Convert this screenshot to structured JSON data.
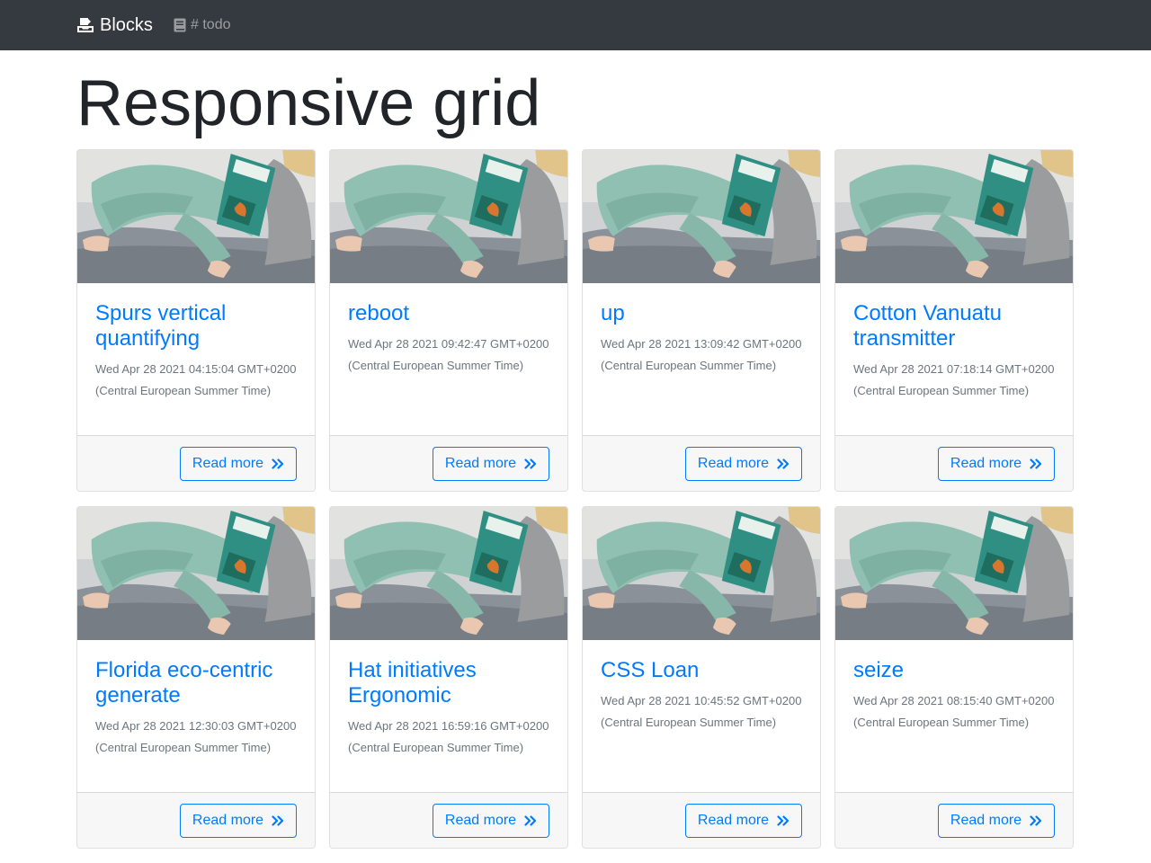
{
  "navbar": {
    "brand_label": "Blocks",
    "brand_icon": "inbox-tray-icon",
    "link_label": "# todo",
    "link_icon": "book-icon"
  },
  "page": {
    "title": "Responsive grid"
  },
  "theme": {
    "navbar_bg": "#343a40",
    "accent": "#007bff",
    "muted": "#6c757d",
    "footer_bg": "#f7f7f7"
  },
  "cards": [
    {
      "title": "Spurs vertical quantifying",
      "date": "Wed Apr 28 2021 04:15:04 GMT+0200 (Central European Summer Time)",
      "button": "Read more",
      "button_icon": "angle-double-right-icon",
      "image": "child-reading-book-on-sofa"
    },
    {
      "title": "reboot",
      "date": "Wed Apr 28 2021 09:42:47 GMT+0200 (Central European Summer Time)",
      "button": "Read more",
      "button_icon": "angle-double-right-icon",
      "image": "child-reading-book-on-sofa"
    },
    {
      "title": "up",
      "date": "Wed Apr 28 2021 13:09:42 GMT+0200 (Central European Summer Time)",
      "button": "Read more",
      "button_icon": "angle-double-right-icon",
      "image": "child-reading-book-on-sofa"
    },
    {
      "title": "Cotton Vanuatu transmitter",
      "date": "Wed Apr 28 2021 07:18:14 GMT+0200 (Central European Summer Time)",
      "button": "Read more",
      "button_icon": "angle-double-right-icon",
      "image": "child-reading-book-on-sofa"
    },
    {
      "title": "Florida eco-centric generate",
      "date": "Wed Apr 28 2021 12:30:03 GMT+0200 (Central European Summer Time)",
      "button": "Read more",
      "button_icon": "angle-double-right-icon",
      "image": "child-reading-book-on-sofa"
    },
    {
      "title": "Hat initiatives Ergonomic",
      "date": "Wed Apr 28 2021 16:59:16 GMT+0200 (Central European Summer Time)",
      "button": "Read more",
      "button_icon": "angle-double-right-icon",
      "image": "child-reading-book-on-sofa"
    },
    {
      "title": "CSS Loan",
      "date": "Wed Apr 28 2021 10:45:52 GMT+0200 (Central European Summer Time)",
      "button": "Read more",
      "button_icon": "angle-double-right-icon",
      "image": "child-reading-book-on-sofa"
    },
    {
      "title": "seize",
      "date": "Wed Apr 28 2021 08:15:40 GMT+0200 (Central European Summer Time)",
      "button": "Read more",
      "button_icon": "angle-double-right-icon",
      "image": "child-reading-book-on-sofa"
    }
  ]
}
